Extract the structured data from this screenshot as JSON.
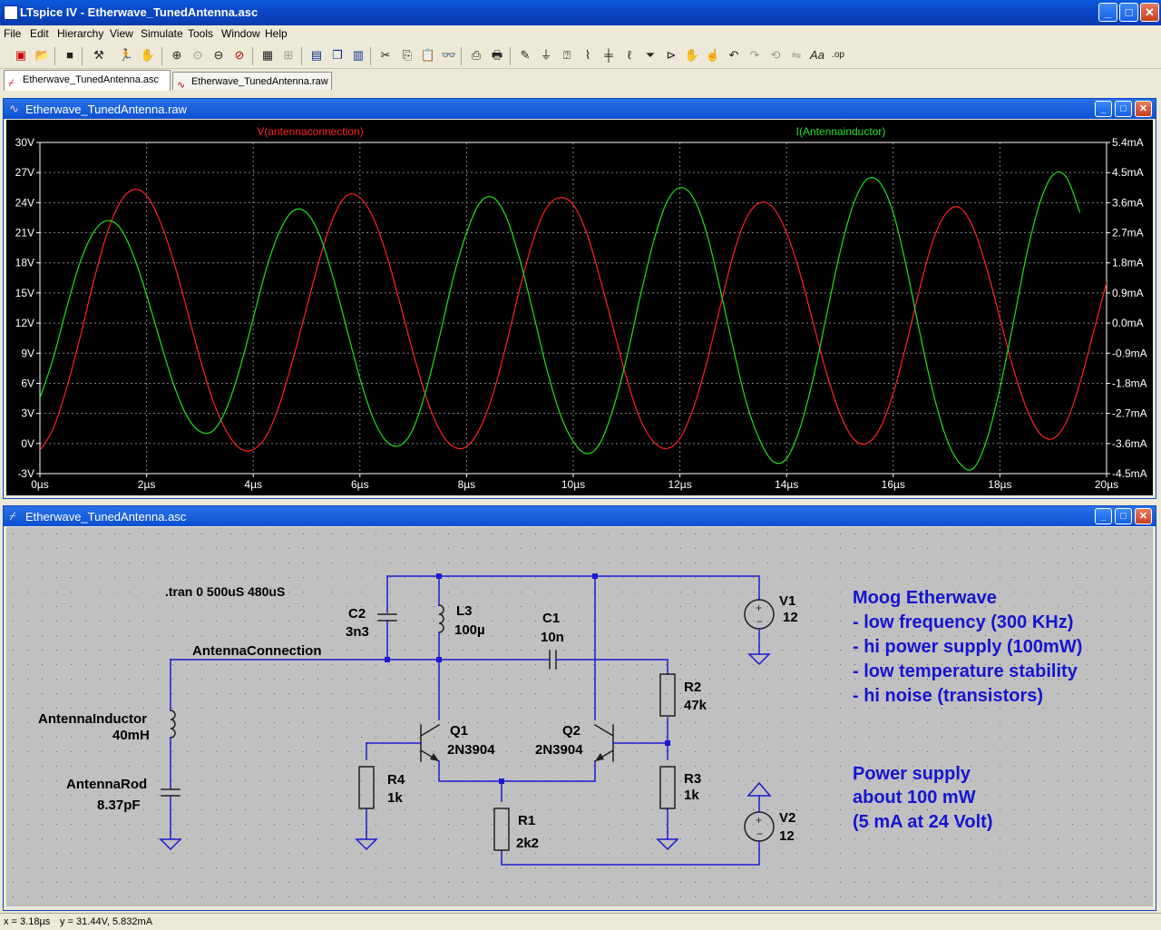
{
  "app": {
    "title": "LTspice IV - Etherwave_TunedAntenna.asc",
    "min": "_",
    "max": "□",
    "close": "✕"
  },
  "menu": [
    "File",
    "Edit",
    "Hierarchy",
    "View",
    "Simulate",
    "Tools",
    "Window",
    "Help"
  ],
  "toolbar_icons": [
    "new-schematic-icon",
    "open-icon",
    "save-icon",
    "control-panel-icon",
    "run-icon",
    "halt-icon",
    "zoom-in-icon",
    "zoom-pan-icon",
    "zoom-out-icon",
    "zoom-cancel-icon",
    "autoscale-icon",
    "grid-icon",
    "tile-horizontal-icon",
    "cascade-icon",
    "tile-vertical-icon",
    "cut-icon",
    "copy-icon",
    "paste-icon",
    "find-icon",
    "print-setup-icon",
    "print-icon",
    "draw-wire-icon",
    "ground-icon",
    "label-net-icon",
    "resistor-icon",
    "capacitor-icon",
    "inductor-icon",
    "diode-icon",
    "component-icon",
    "move-icon",
    "drag-icon",
    "undo-icon",
    "redo-icon",
    "rotate-icon",
    "mirror-icon",
    "text-icon",
    "spice-directive-icon"
  ],
  "tabs": [
    {
      "label": "Etherwave_TunedAntenna.asc",
      "active": true
    },
    {
      "label": "Etherwave_TunedAntenna.raw",
      "active": false
    }
  ],
  "plot_window": {
    "title": "Etherwave_TunedAntenna.raw"
  },
  "schematic_window": {
    "title": "Etherwave_TunedAntenna.asc"
  },
  "chart_data": {
    "type": "line",
    "x_ticks": [
      "0µs",
      "2µs",
      "4µs",
      "6µs",
      "8µs",
      "10µs",
      "12µs",
      "14µs",
      "16µs",
      "18µs",
      "20µs"
    ],
    "y_left_ticks": [
      "30V",
      "27V",
      "24V",
      "21V",
      "18V",
      "15V",
      "12V",
      "9V",
      "6V",
      "3V",
      "0V",
      "-3V"
    ],
    "y_right_ticks": [
      "5.4mA",
      "4.5mA",
      "3.6mA",
      "2.7mA",
      "1.8mA",
      "0.9mA",
      "0.0mA",
      "-0.9mA",
      "-1.8mA",
      "-2.7mA",
      "-3.6mA",
      "-4.5mA"
    ],
    "xlim": [
      0,
      20
    ],
    "ylim_left": [
      -3,
      30
    ],
    "ylim_right": [
      -4.5,
      5.4
    ],
    "grid": true,
    "colors": {
      "background": "#000000",
      "grid": "#808080",
      "axis_text": "#ffffff"
    },
    "series": [
      {
        "name": "V(antennaconnection)",
        "color": "#ff2020",
        "axis": "left",
        "points": [
          [
            0.0,
            -0.7
          ],
          [
            0.25,
            1.5
          ],
          [
            0.5,
            5.5
          ],
          [
            0.75,
            10.5
          ],
          [
            1.0,
            16.0
          ],
          [
            1.25,
            20.8
          ],
          [
            1.5,
            24.0
          ],
          [
            1.75,
            25.3
          ],
          [
            2.0,
            24.7
          ],
          [
            2.25,
            22.2
          ],
          [
            2.5,
            18.3
          ],
          [
            2.75,
            13.5
          ],
          [
            3.0,
            8.5
          ],
          [
            3.25,
            4.2
          ],
          [
            3.5,
            1.2
          ],
          [
            3.75,
            -0.5
          ],
          [
            4.0,
            -0.6
          ],
          [
            4.25,
            0.8
          ],
          [
            4.5,
            4.0
          ],
          [
            4.75,
            8.5
          ],
          [
            5.0,
            13.5
          ],
          [
            5.25,
            18.5
          ],
          [
            5.5,
            22.5
          ],
          [
            5.75,
            24.7
          ],
          [
            6.0,
            24.5
          ],
          [
            6.25,
            22.5
          ],
          [
            6.5,
            18.8
          ],
          [
            6.75,
            14.0
          ],
          [
            7.0,
            9.0
          ],
          [
            7.25,
            4.5
          ],
          [
            7.5,
            1.3
          ],
          [
            7.75,
            -0.3
          ],
          [
            8.0,
            -0.3
          ],
          [
            8.25,
            1.5
          ],
          [
            8.5,
            5.0
          ],
          [
            8.75,
            10.0
          ],
          [
            9.0,
            15.5
          ],
          [
            9.25,
            20.3
          ],
          [
            9.5,
            23.5
          ],
          [
            9.75,
            24.5
          ],
          [
            10.0,
            23.8
          ],
          [
            10.25,
            21.0
          ],
          [
            10.5,
            16.5
          ],
          [
            10.75,
            11.5
          ],
          [
            11.0,
            6.5
          ],
          [
            11.25,
            2.5
          ],
          [
            11.5,
            0.2
          ],
          [
            11.75,
            -0.5
          ],
          [
            12.0,
            0.5
          ],
          [
            12.25,
            3.5
          ],
          [
            12.5,
            8.0
          ],
          [
            12.75,
            13.5
          ],
          [
            13.0,
            18.8
          ],
          [
            13.25,
            22.5
          ],
          [
            13.5,
            24.0
          ],
          [
            13.75,
            23.5
          ],
          [
            14.0,
            21.0
          ],
          [
            14.25,
            17.0
          ],
          [
            14.5,
            12.0
          ],
          [
            14.75,
            7.0
          ],
          [
            15.0,
            3.0
          ],
          [
            15.25,
            0.5
          ],
          [
            15.5,
            0.0
          ],
          [
            15.75,
            1.5
          ],
          [
            16.0,
            5.0
          ],
          [
            16.25,
            10.0
          ],
          [
            16.5,
            15.5
          ],
          [
            16.75,
            20.3
          ],
          [
            17.0,
            23.0
          ],
          [
            17.25,
            23.5
          ],
          [
            17.5,
            21.5
          ],
          [
            17.75,
            17.5
          ],
          [
            18.0,
            12.5
          ],
          [
            18.25,
            7.5
          ],
          [
            18.5,
            3.5
          ],
          [
            18.75,
            1.0
          ],
          [
            19.0,
            0.5
          ],
          [
            19.25,
            2.2
          ],
          [
            19.5,
            6.0
          ],
          [
            19.75,
            11.0
          ],
          [
            20.0,
            16.0
          ],
          [
            20.25,
            20.3
          ],
          [
            20.5,
            22.3
          ]
        ]
      },
      {
        "name": "I(Antennainductor)",
        "color": "#20e020",
        "axis": "left",
        "points": [
          [
            0.0,
            4.5
          ],
          [
            0.25,
            8.5
          ],
          [
            0.5,
            13.5
          ],
          [
            0.75,
            18.0
          ],
          [
            1.0,
            21.0
          ],
          [
            1.25,
            22.2
          ],
          [
            1.5,
            21.5
          ],
          [
            1.75,
            18.8
          ],
          [
            2.0,
            14.8
          ],
          [
            2.25,
            10.3
          ],
          [
            2.5,
            6.0
          ],
          [
            2.75,
            2.8
          ],
          [
            3.0,
            1.2
          ],
          [
            3.25,
            1.3
          ],
          [
            3.5,
            3.5
          ],
          [
            3.75,
            7.5
          ],
          [
            4.0,
            12.5
          ],
          [
            4.25,
            17.5
          ],
          [
            4.5,
            21.2
          ],
          [
            4.75,
            23.2
          ],
          [
            5.0,
            23.0
          ],
          [
            5.25,
            20.7
          ],
          [
            5.5,
            16.5
          ],
          [
            5.75,
            11.5
          ],
          [
            6.0,
            6.5
          ],
          [
            6.25,
            2.5
          ],
          [
            6.5,
            0.2
          ],
          [
            6.75,
            -0.2
          ],
          [
            7.0,
            1.5
          ],
          [
            7.25,
            5.5
          ],
          [
            7.5,
            10.8
          ],
          [
            7.75,
            16.5
          ],
          [
            8.0,
            21.0
          ],
          [
            8.25,
            24.0
          ],
          [
            8.5,
            24.5
          ],
          [
            8.75,
            22.5
          ],
          [
            9.0,
            18.3
          ],
          [
            9.25,
            13.0
          ],
          [
            9.5,
            7.5
          ],
          [
            9.75,
            3.0
          ],
          [
            10.0,
            0.2
          ],
          [
            10.25,
            -1.0
          ],
          [
            10.5,
            0.0
          ],
          [
            10.75,
            3.5
          ],
          [
            11.0,
            8.5
          ],
          [
            11.25,
            14.5
          ],
          [
            11.5,
            20.0
          ],
          [
            11.75,
            24.0
          ],
          [
            12.0,
            25.5
          ],
          [
            12.25,
            24.5
          ],
          [
            12.5,
            21.0
          ],
          [
            12.75,
            15.5
          ],
          [
            13.0,
            9.5
          ],
          [
            13.25,
            4.0
          ],
          [
            13.5,
            0.3
          ],
          [
            13.75,
            -1.8
          ],
          [
            14.0,
            -1.5
          ],
          [
            14.25,
            1.5
          ],
          [
            14.5,
            6.5
          ],
          [
            14.75,
            12.8
          ],
          [
            15.0,
            19.0
          ],
          [
            15.25,
            23.8
          ],
          [
            15.5,
            26.3
          ],
          [
            15.75,
            26.0
          ],
          [
            16.0,
            23.0
          ],
          [
            16.25,
            17.5
          ],
          [
            16.5,
            11.0
          ],
          [
            16.75,
            5.0
          ],
          [
            17.0,
            0.5
          ],
          [
            17.25,
            -2.0
          ],
          [
            17.5,
            -2.5
          ],
          [
            17.75,
            0.3
          ],
          [
            18.0,
            5.5
          ],
          [
            18.25,
            12.0
          ],
          [
            18.5,
            18.8
          ],
          [
            18.75,
            24.0
          ],
          [
            19.0,
            26.8
          ],
          [
            19.25,
            26.5
          ],
          [
            19.5,
            23.0
          ]
        ]
      }
    ]
  },
  "schematic": {
    "directive": ".tran 0 500uS 480uS",
    "net_label": "AntennaConnection",
    "components": {
      "C2": {
        "name": "C2",
        "value": "3n3"
      },
      "L3": {
        "name": "L3",
        "value": "100µ"
      },
      "C1": {
        "name": "C1",
        "value": "10n"
      },
      "V1": {
        "name": "V1",
        "value": "12"
      },
      "V2": {
        "name": "V2",
        "value": "12"
      },
      "R2": {
        "name": "R2",
        "value": "47k"
      },
      "R3": {
        "name": "R3",
        "value": "1k"
      },
      "R4": {
        "name": "R4",
        "value": "1k"
      },
      "R1": {
        "name": "R1",
        "value": "2k2"
      },
      "Q1": {
        "name": "Q1",
        "value": "2N3904"
      },
      "Q2": {
        "name": "Q2",
        "value": "2N3904"
      },
      "LA": {
        "name": "AntennaInductor",
        "value": "40mH"
      },
      "CA": {
        "name": "AntennaRod",
        "value": "8.37pF"
      }
    },
    "notes": [
      "Moog Etherwave",
      "- low frequency (300 KHz)",
      "- hi power supply (100mW)",
      "- low temperature stability",
      "- hi noise (transistors)",
      "Power supply",
      "about 100 mW",
      "(5 mA at 24 Volt)"
    ],
    "colors": {
      "background": "#c0c0c0",
      "wire": "#1a1ad0",
      "component": "#202020",
      "text": "#000000",
      "note": "#1515d0"
    }
  },
  "status": {
    "x": "x = 3.18µs",
    "y": "y = 31.44V, 5.832mA"
  }
}
